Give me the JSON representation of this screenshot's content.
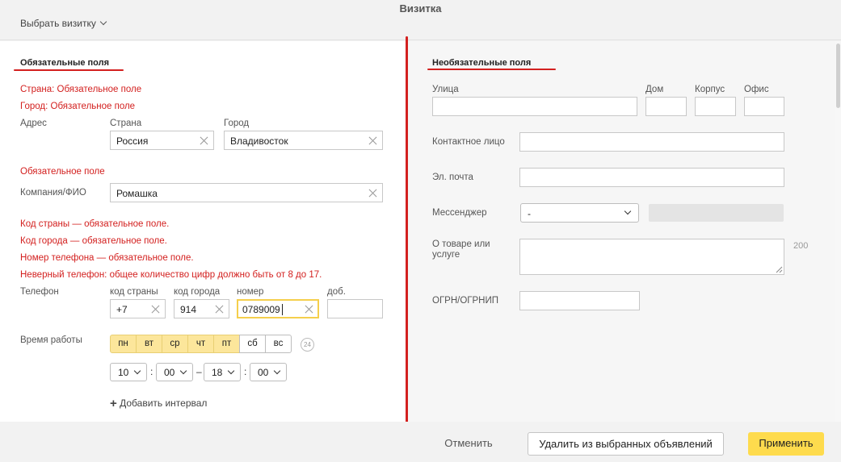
{
  "header": {
    "title": "Визитка",
    "select_label": "Выбрать визитку"
  },
  "required": {
    "section_title": "Обязательные поля",
    "errors_address": [
      "Страна: Обязательное поле",
      "Город: Обязательное поле"
    ],
    "address_label": "Адрес",
    "country_label": "Страна",
    "country_value": "Россия",
    "city_label": "Город",
    "city_value": "Владивосток",
    "company_error": "Обязательное поле",
    "company_label": "Компания/ФИО",
    "company_value": "Ромашка",
    "phone_errors": [
      "Код страны — обязательное поле.",
      "Код города — обязательное поле.",
      "Номер телефона — обязательное поле.",
      "Неверный телефон: общее количество цифр должно быть от 8 до 17."
    ],
    "phone_label": "Телефон",
    "country_code_label": "код страны",
    "country_code_value": "+7",
    "city_code_label": "код города",
    "city_code_value": "914",
    "number_label": "номер",
    "number_value": "0789009",
    "ext_label": "доб.",
    "ext_value": "",
    "hours_label": "Время работы",
    "days": [
      {
        "label": "пн",
        "selected": true
      },
      {
        "label": "вт",
        "selected": true
      },
      {
        "label": "ср",
        "selected": true
      },
      {
        "label": "чт",
        "selected": true
      },
      {
        "label": "пт",
        "selected": true
      },
      {
        "label": "сб",
        "selected": false
      },
      {
        "label": "вс",
        "selected": false
      }
    ],
    "badge_24": "24",
    "time_from_hour": "10",
    "time_from_min": "00",
    "time_to_hour": "18",
    "time_to_min": "00",
    "colon": ":",
    "dash": "–",
    "add_interval": "Добавить интервал"
  },
  "optional": {
    "section_title": "Необязательные поля",
    "street_label": "Улица",
    "house_label": "Дом",
    "building_label": "Корпус",
    "office_label": "Офис",
    "contact_label": "Контактное лицо",
    "email_label": "Эл. почта",
    "messenger_label": "Мессенджер",
    "messenger_value": "-",
    "product_label": "О товаре или услуге",
    "product_counter": "200",
    "ogrn_label": "ОГРН/ОГРНИП"
  },
  "footer": {
    "cancel": "Отменить",
    "remove": "Удалить из выбранных объявлений",
    "apply": "Применить"
  },
  "colors": {
    "error": "#d3201f",
    "accent": "#fedb4d",
    "day_selected": "#fce69b"
  }
}
